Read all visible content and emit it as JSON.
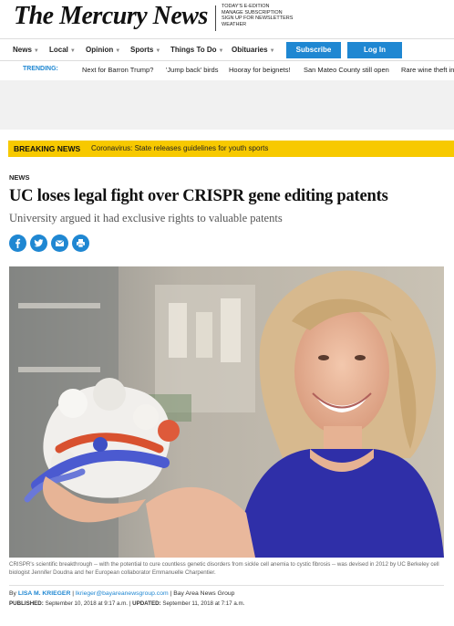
{
  "masthead": {
    "logo": "The Mercury News",
    "links": [
      "TODAY'S E-EDITION",
      "MANAGE SUBSCRIPTION",
      "SIGN UP FOR NEWSLETTERS",
      "WEATHER"
    ]
  },
  "nav": {
    "items": [
      "News",
      "Local",
      "Opinion",
      "Sports",
      "Things To Do",
      "Obituaries"
    ],
    "subscribe": "Subscribe",
    "login": "Log In"
  },
  "trending": {
    "label": "TRENDING:",
    "items": [
      "Next for Barron Trump?",
      "'Jump back' birds",
      "Hooray for beignets!",
      "San Mateo County still open",
      "Rare wine theft in"
    ]
  },
  "breaking": {
    "label": "BREAKING NEWS",
    "text": "Coronavirus: State releases guidelines for youth sports"
  },
  "article": {
    "section": "NEWS",
    "headline": "UC loses legal fight over CRISPR gene editing patents",
    "subhead": "University argued it had exclusive rights to valuable patents",
    "share_icons": [
      "facebook-icon",
      "twitter-icon",
      "email-icon",
      "print-icon"
    ],
    "caption": "CRISPR's scientific breakthrough -- with the potential to cure countless genetic disorders from sickle cell anemia to cystic fibrosis -- was devised in 2012 by UC Berkeley cell biologist Jennifer Doudna and her European collaborator Emmanuelle Charpentier.",
    "byline_prefix": "By",
    "author": "LISA M. KRIEGER",
    "email": "lkrieger@bayareanewsgroup.com",
    "org": "Bay Area News Group",
    "published_label": "PUBLISHED:",
    "published": "September 10, 2018 at 9:17 a.m.",
    "updated_label": "UPDATED:",
    "updated": "September 11, 2018 at 7:17 a.m."
  },
  "colors": {
    "accent": "#1f87d2",
    "breaking": "#f7c900"
  }
}
